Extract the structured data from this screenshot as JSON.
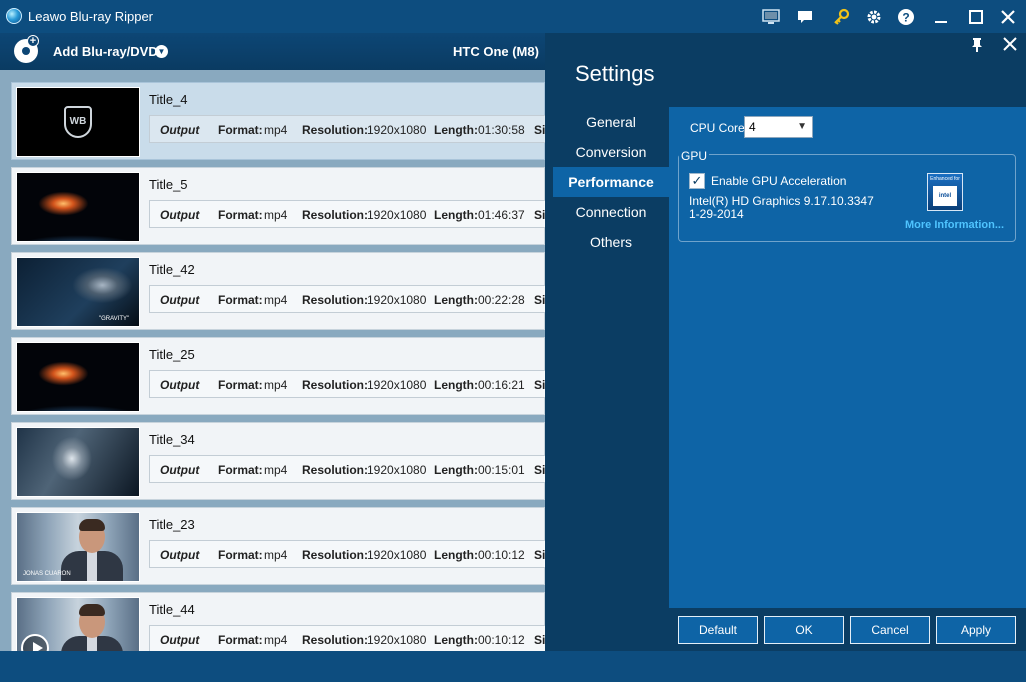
{
  "window": {
    "title": "Leawo Blu-ray Ripper"
  },
  "toolbar": {
    "add_label": "Add Blu-ray/DVD",
    "device": "HTC One (M8)"
  },
  "titles": [
    {
      "name": "Title_4",
      "output": "Output",
      "format_label": "Format:",
      "format": "mp4",
      "res_label": "Resolution:",
      "resolution": "1920x1080",
      "length_label": "Length:",
      "length": "01:30:58",
      "size_label": "Siz",
      "thumb": "warner-bros-logo"
    },
    {
      "name": "Title_5",
      "output": "Output",
      "format_label": "Format:",
      "format": "mp4",
      "res_label": "Resolution:",
      "resolution": "1920x1080",
      "length_label": "Length:",
      "length": "01:46:37",
      "size_label": "Siz",
      "thumb": "debris-fire"
    },
    {
      "name": "Title_42",
      "output": "Output",
      "format_label": "Format:",
      "format": "mp4",
      "res_label": "Resolution:",
      "resolution": "1920x1080",
      "length_label": "Length:",
      "length": "00:22:28",
      "size_label": "Siz",
      "thumb": "space-station",
      "thumb_caption": "\"GRAVITY\""
    },
    {
      "name": "Title_25",
      "output": "Output",
      "format_label": "Format:",
      "format": "mp4",
      "res_label": "Resolution:",
      "resolution": "1920x1080",
      "length_label": "Length:",
      "length": "00:16:21",
      "size_label": "Siz",
      "thumb": "debris-fire"
    },
    {
      "name": "Title_34",
      "output": "Output",
      "format_label": "Format:",
      "format": "mp4",
      "res_label": "Resolution:",
      "resolution": "1920x1080",
      "length_label": "Length:",
      "length": "00:15:01",
      "size_label": "Siz",
      "thumb": "astronaut"
    },
    {
      "name": "Title_23",
      "output": "Output",
      "format_label": "Format:",
      "format": "mp4",
      "res_label": "Resolution:",
      "resolution": "1920x1080",
      "length_label": "Length:",
      "length": "00:10:12",
      "size_label": "Siz",
      "thumb": "interview",
      "thumb_caption": "JONAS CUARON"
    },
    {
      "name": "Title_44",
      "output": "Output",
      "format_label": "Format:",
      "format": "mp4",
      "res_label": "Resolution:",
      "resolution": "1920x1080",
      "length_label": "Length:",
      "length": "00:10:12",
      "size_label": "Siz",
      "thumb": "interview"
    }
  ],
  "settings": {
    "title": "Settings",
    "nav": [
      "General",
      "Conversion",
      "Performance",
      "Connection",
      "Others"
    ],
    "active_nav": "Performance",
    "cpu_core_label": "CPU Core",
    "cpu_core_value": "4",
    "gpu_legend": "GPU",
    "gpu_enable_label": "Enable GPU Acceleration",
    "gpu_enabled": true,
    "gpu_name": "Intel(R) HD Graphics 9.17.10.3347",
    "gpu_date": "1-29-2014",
    "intel_badge_top": "Enhanced for",
    "intel_badge_inner": "intel",
    "more_info": "More Information...",
    "buttons": {
      "default": "Default",
      "ok": "OK",
      "cancel": "Cancel",
      "apply": "Apply"
    }
  },
  "colors": {
    "titlebar": "#0d4d7f",
    "panel": "#0b3d63",
    "accent": "#0e64a6",
    "link": "#4fc4ff",
    "selected_row": "#c9dcea"
  }
}
